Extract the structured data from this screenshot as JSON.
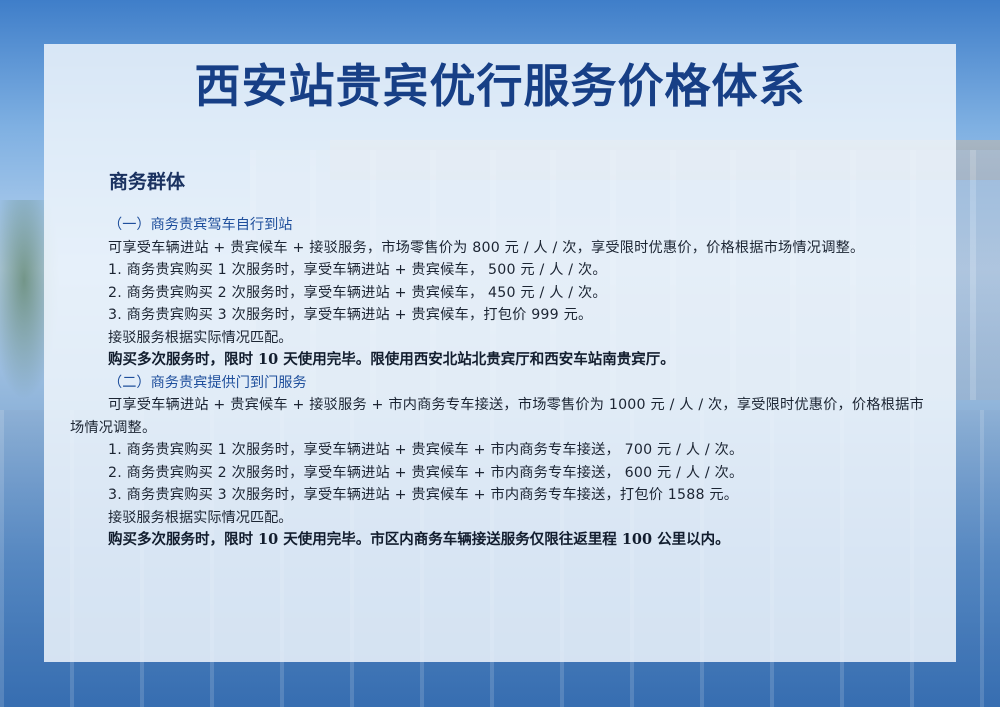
{
  "title": "西安站贵宾优行服务价格体系",
  "group_title": "商务群体",
  "section1": {
    "heading": "（一）商务贵宾驾车自行到站",
    "intro": "可享受车辆进站 + 贵宾候车 + 接驳服务，市场零售价为 800 元 / 人 / 次，享受限时优惠价，价格根据市场情况调整。",
    "items": [
      "1. 商务贵宾购买 1 次服务时，享受车辆进站 + 贵宾候车， 500 元 / 人 / 次。",
      "2. 商务贵宾购买 2 次服务时，享受车辆进站 + 贵宾候车， 450 元 / 人 / 次。",
      "3. 商务贵宾购买 3 次服务时，享受车辆进站 + 贵宾候车，打包价 999 元。"
    ],
    "note": "接驳服务根据实际情况匹配。",
    "bold_note": "购买多次服务时，限时 10 天使用完毕。限使用西安北站北贵宾厅和西安车站南贵宾厅。"
  },
  "section2": {
    "heading": "（二）商务贵宾提供门到门服务",
    "intro": "可享受车辆进站 + 贵宾候车 + 接驳服务 + 市内商务专车接送，市场零售价为 1000 元 / 人 / 次，享受限时优惠价，价格根据市场情况调整。",
    "items": [
      "1. 商务贵宾购买 1 次服务时，享受车辆进站 + 贵宾候车 + 市内商务专车接送， 700 元 / 人 / 次。",
      "2. 商务贵宾购买 2 次服务时，享受车辆进站 + 贵宾候车 + 市内商务专车接送， 600 元 / 人 / 次。",
      "3. 商务贵宾购买 3 次服务时，享受车辆进站 + 贵宾候车 + 市内商务专车接送，打包价 1588 元。"
    ],
    "note": "接驳服务根据实际情况匹配。",
    "bold_note": "购买多次服务时，限时 10 天使用完毕。市区内商务车辆接送服务仅限往返里程 100 公里以内。"
  },
  "colors": {
    "title": "#173f86",
    "subheading": "#1f4f9c",
    "panel": "#eef4fb"
  }
}
